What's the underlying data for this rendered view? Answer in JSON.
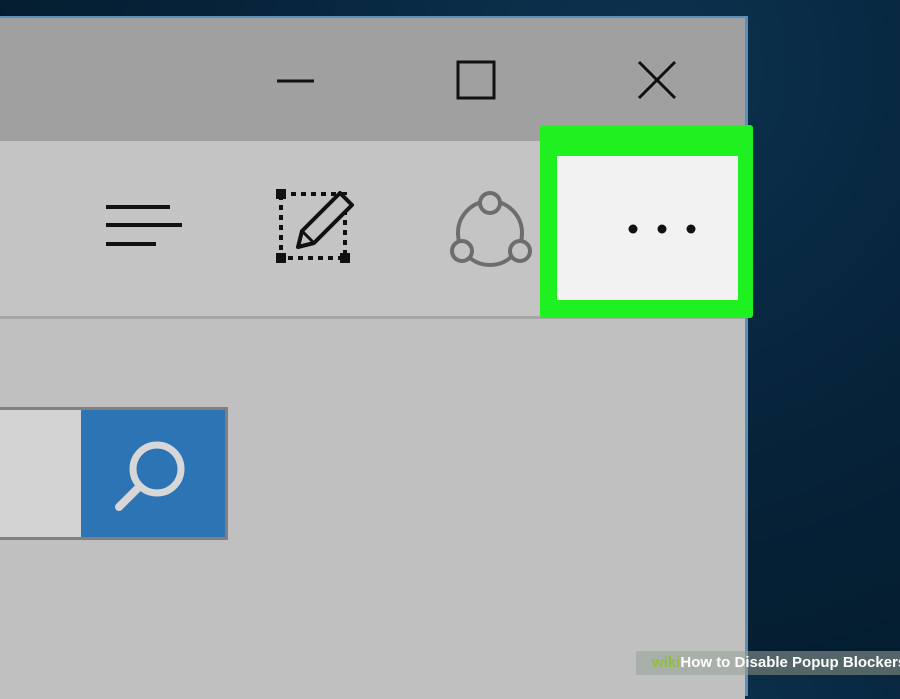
{
  "window": {
    "controls": {
      "minimize_icon": "minimize-icon",
      "maximize_icon": "maximize-icon",
      "close_icon": "close-icon"
    },
    "toolbar": {
      "hub_icon": "hub-lines-icon",
      "web_note_icon": "web-note-pen-icon",
      "share_icon": "share-icon",
      "more_label": "...",
      "highlight_color": "#1ff01f"
    },
    "search": {
      "value": "",
      "button_icon": "search-icon",
      "button_color": "#2c74b3"
    }
  },
  "watermark": {
    "brand": "wiki",
    "text": "How to Disable Popup Blockers"
  }
}
